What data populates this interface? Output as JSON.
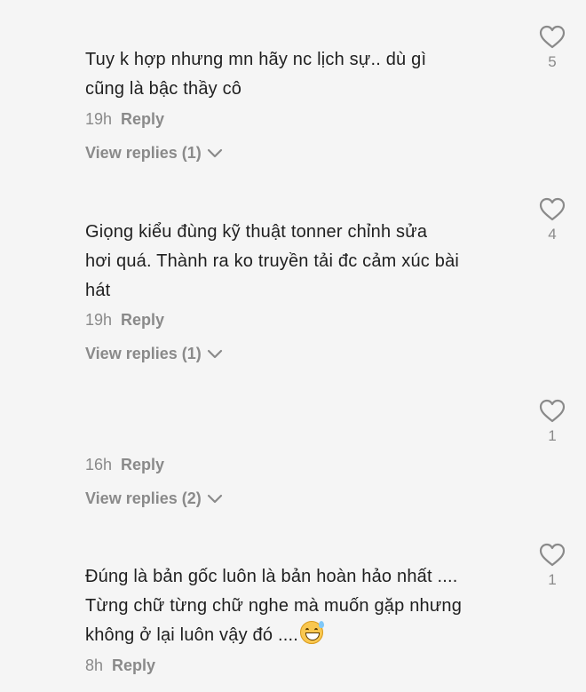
{
  "comments": [
    {
      "lines": [
        "Tuy k hợp nhưng mn hãy nc lịch sự.. dù gì",
        "cũng là bậc thầy cô"
      ],
      "time": "19h",
      "reply_label": "Reply",
      "view_replies": "View replies (1)",
      "likes": "5"
    },
    {
      "lines": [
        "Giọng kiểu đùng kỹ thuật tonner chỉnh sửa",
        "hơi quá. Thành ra ko truyền tải đc cảm xúc bài",
        "hát"
      ],
      "time": "19h",
      "reply_label": "Reply",
      "view_replies": "View replies (1)",
      "likes": "4"
    },
    {
      "lines": [],
      "time": "16h",
      "reply_label": "Reply",
      "view_replies": "View replies (2)",
      "likes": "1"
    },
    {
      "lines": [
        "Đúng là bản gốc luôn là bản hoàn hảo nhất ....",
        "Từng chữ từng chữ nghe mà muốn gặp nhưng",
        "không ở lại luôn vậy đó ...."
      ],
      "emoji": "grinning-face-with-sweat",
      "time": "8h",
      "reply_label": "Reply",
      "likes": "1"
    }
  ],
  "colors": {
    "background": "#f5f5f5",
    "text": "#1f1f1f",
    "muted": "#8a8a8a"
  },
  "icons": {
    "like": "heart-outline-icon",
    "expand": "chevron-down-icon"
  }
}
